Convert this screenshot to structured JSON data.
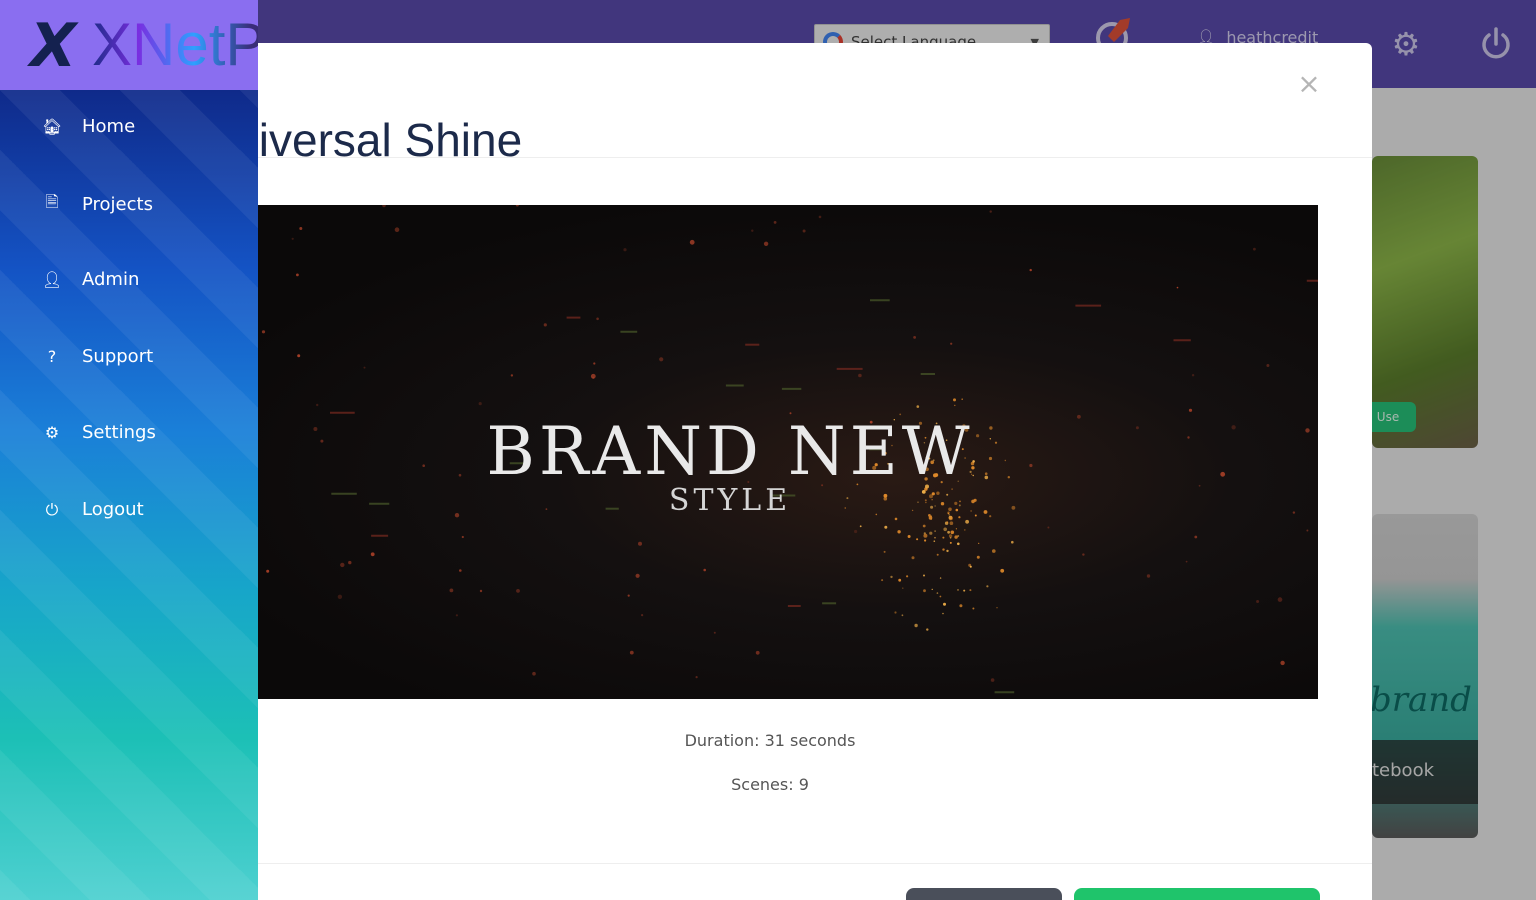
{
  "header": {
    "language_select_label": "Select Language",
    "language_select_caret": "▼",
    "username": "heathcredit"
  },
  "sidebar": {
    "logo_mark": "X",
    "logo_text": "XNetPro",
    "items": [
      {
        "label": "Home",
        "icon": "home-icon",
        "glyph": "🏠︎"
      },
      {
        "label": "Projects",
        "icon": "file-icon",
        "glyph": "🗎"
      },
      {
        "label": "Admin",
        "icon": "user-icon",
        "glyph": "👤︎"
      },
      {
        "label": "Support",
        "icon": "help-icon",
        "glyph": "?"
      },
      {
        "label": "Settings",
        "icon": "gear-icon",
        "glyph": "⚙"
      },
      {
        "label": "Logout",
        "icon": "power-icon",
        "glyph": "⏻"
      }
    ]
  },
  "background_cards": {
    "green_badge": "Use",
    "teal_script": "brand",
    "teal_caption": "tebook"
  },
  "modal": {
    "title": "Universal Shine",
    "close_glyph": "×",
    "preview_title": "BRAND NEW",
    "preview_subtitle": "STYLE",
    "duration": "Duration: 31 seconds",
    "scenes": "Scenes: 9"
  },
  "colors": {
    "topbar": "#5b4cad",
    "sidebar_top": "#0f2a8a",
    "sidebar_bottom": "#4ed0d0",
    "primary_button": "#1fc46b",
    "secondary_button": "#4a4f5a"
  }
}
